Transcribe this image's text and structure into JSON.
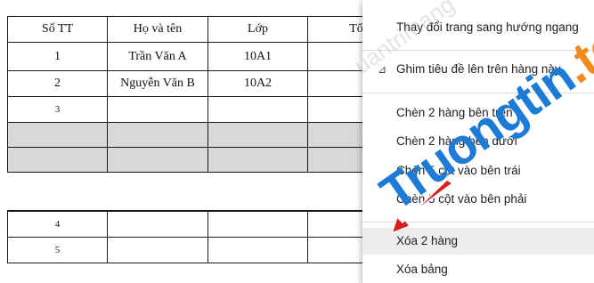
{
  "table_top": {
    "headers": [
      "Số TT",
      "Họ và tên",
      "Lớp",
      "Tổng"
    ],
    "rows": [
      [
        "1",
        "Trần Văn A",
        "10A1",
        ""
      ],
      [
        "2",
        "Nguyễn Văn B",
        "10A2",
        ""
      ],
      [
        "3",
        "",
        "",
        ""
      ],
      [
        "",
        "",
        "",
        ""
      ],
      [
        "",
        "",
        "",
        ""
      ]
    ]
  },
  "table_bottom": {
    "rows": [
      [
        "",
        "",
        "",
        ""
      ],
      [
        "4",
        "",
        "",
        ""
      ],
      [
        "5",
        "",
        "",
        ""
      ]
    ]
  },
  "context_menu": {
    "items": [
      {
        "label": "Thay đổi trang sang hướng ngang"
      },
      {
        "label": "Ghim tiêu đề lên trên hàng này",
        "icon": "pin-icon"
      },
      {
        "label": "Chèn 2 hàng bên trên"
      },
      {
        "label": "Chèn 2 hàng bên dưới"
      },
      {
        "label": "Chèn 5 cột vào bên trái"
      },
      {
        "label": "Chèn 5 cột vào bên phải"
      },
      {
        "label": "Xóa 2 hàng",
        "highlighted": true
      },
      {
        "label": "Xóa bảng"
      }
    ]
  },
  "watermark": {
    "part1": "Truong",
    "part2": "tin",
    "part3": ".top",
    "light": "uantrimang"
  },
  "colors": {
    "shaded_row": "#d9d9d9",
    "hover": "#ededed",
    "watermark_blue": "#1b7bd6",
    "watermark_orange": "#f28a1a",
    "arrow_red": "#d81f1f"
  }
}
